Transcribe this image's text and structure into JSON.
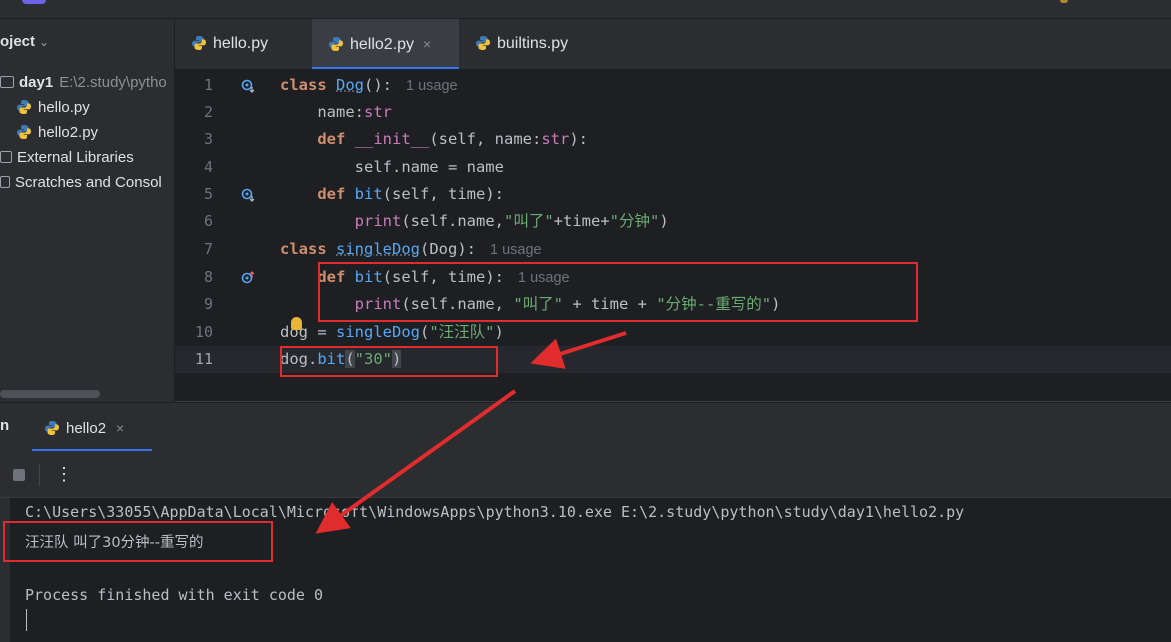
{
  "project": {
    "header": "oject",
    "tree": [
      {
        "label": "day1",
        "path": "E:\\2.study\\pytho",
        "kind": "folder"
      },
      {
        "label": "hello.py",
        "kind": "python"
      },
      {
        "label": "hello2.py",
        "kind": "python"
      },
      {
        "label": "External Libraries",
        "kind": "library"
      },
      {
        "label": "Scratches and Consol",
        "kind": "scratch"
      }
    ]
  },
  "tabs": [
    {
      "label": "hello.py",
      "active": false
    },
    {
      "label": "hello2.py",
      "active": true,
      "close": "×"
    },
    {
      "label": "builtins.py",
      "active": false
    }
  ],
  "editor": {
    "line_numbers": [
      "1",
      "2",
      "3",
      "4",
      "5",
      "6",
      "7",
      "8",
      "9",
      "10",
      "11"
    ],
    "usage_1": "1 usage",
    "usage_7": "1 usage",
    "usage_8": "1 usage",
    "lines": {
      "l1": {
        "kw": "class",
        "name": "Dog",
        "rest": "():"
      },
      "l2": {
        "text": "name:",
        "type": "str"
      },
      "l3": {
        "kw": "def",
        "name": "__init__",
        "rest": "(self, name:",
        "type": "str",
        "end": "):"
      },
      "l4": {
        "text": "self.name = name"
      },
      "l5": {
        "kw": "def",
        "name": "bit",
        "rest": "(self, time):"
      },
      "l6": {
        "fn": "print",
        "rest": "(self.name,",
        "s1": "\"叫了\"",
        "mid": "+time+",
        "s2": "\"分钟\"",
        "end": ")"
      },
      "l7": {
        "kw": "class",
        "name": "singleDog",
        "rest": "(Dog):"
      },
      "l8": {
        "kw": "def",
        "name": "bit",
        "rest": "(self, time):"
      },
      "l9": {
        "fn": "print",
        "rest": "(self.name, ",
        "s1": "\"叫了\"",
        "mid": " + time + ",
        "s2": "\"分钟--重写的\"",
        "end": ")"
      },
      "l10": {
        "text": "dog = ",
        "call": "singleDog",
        "open": "(",
        "s1": "\"汪汪队\"",
        "end": ")"
      },
      "l11": {
        "text": "dog.",
        "call": "bit",
        "open": "(",
        "s1": "\"30\"",
        "end": ")"
      }
    }
  },
  "run": {
    "title": "n",
    "tab": "hello2",
    "close": "×",
    "more": "⋮",
    "output": [
      "C:\\Users\\33055\\AppData\\Local\\Microsoft\\WindowsApps\\python3.10.exe E:\\2.study\\python\\study\\day1\\hello2.py",
      "汪汪队 叫了30分钟--重写的",
      "",
      "Process finished with exit code 0"
    ]
  },
  "colors": {
    "keyword": "#cf8e6d",
    "function": "#56a8f5",
    "string": "#6aab73",
    "annotation_red": "#e02c2c",
    "accent": "#3574f0"
  }
}
